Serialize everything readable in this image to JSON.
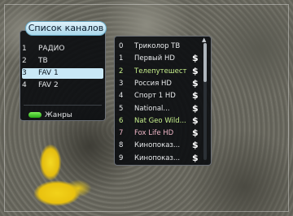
{
  "left_panel": {
    "title": "Список каналов",
    "items": [
      {
        "num": "1",
        "label": "РАДИО",
        "selected": false
      },
      {
        "num": "2",
        "label": "ТВ",
        "selected": false
      },
      {
        "num": "3",
        "label": "FAV 1",
        "selected": true
      },
      {
        "num": "4",
        "label": "FAV 2",
        "selected": false
      }
    ],
    "genres_label": "Жанры",
    "green_key_color": "#3fcf2a",
    "selection_color": "#c9e8f6"
  },
  "channel_list": {
    "scroll_position": 0.0,
    "channels": [
      {
        "num": "0",
        "name": "Триколор ТВ",
        "paid": false,
        "color": "#e8eaec"
      },
      {
        "num": "1",
        "name": "Первый HD",
        "paid": true,
        "color": "#e8eaec"
      },
      {
        "num": "2",
        "name": "Телепутешест",
        "paid": true,
        "color": "#c7f08c"
      },
      {
        "num": "3",
        "name": "Россия HD",
        "paid": true,
        "color": "#e8eaec"
      },
      {
        "num": "4",
        "name": "Спорт 1 HD",
        "paid": true,
        "color": "#e8eaec"
      },
      {
        "num": "5",
        "name": "National...",
        "paid": true,
        "color": "#e8eaec"
      },
      {
        "num": "6",
        "name": "Nat Geo Wild...",
        "paid": true,
        "color": "#c7f08c"
      },
      {
        "num": "7",
        "name": "Fox Life HD",
        "paid": true,
        "color": "#f0b7c8"
      },
      {
        "num": "8",
        "name": "Кинопоказ...",
        "paid": true,
        "color": "#e8eaec"
      },
      {
        "num": "9",
        "name": "Кинопоказ...",
        "paid": true,
        "color": "#e8eaec"
      }
    ],
    "paid_symbol": "$",
    "scroll_up_glyph": "▲"
  }
}
